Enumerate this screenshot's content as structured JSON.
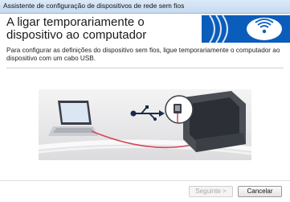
{
  "window": {
    "title": "Assistente de configuração de dispositivos de rede sem fios"
  },
  "header": {
    "title": "A ligar temporariamente o dispositivo ao computador",
    "brand_icon": "wireless-icon"
  },
  "main": {
    "instruction": "Para configurar as definições do dispositivo sem fios, ligue temporariamente o computador ao dispositivo com um cabo USB.",
    "illustration_icons": [
      "laptop-icon",
      "usb-icon",
      "printer-icon"
    ]
  },
  "footer": {
    "next_label": "Seguinte >",
    "cancel_label": "Cancelar"
  },
  "colors": {
    "banner": "#0b5dbb",
    "cable": "#d2475a",
    "panel": "#e9e9ea"
  }
}
